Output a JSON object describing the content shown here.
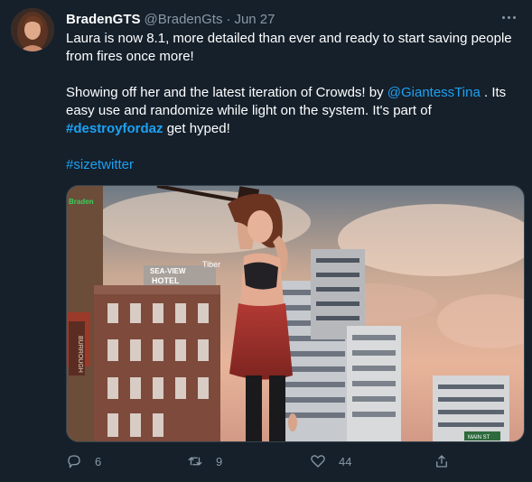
{
  "tweet": {
    "display_name": "BradenGTS",
    "handle": "@BradenGts",
    "separator": "·",
    "date": "Jun 27",
    "text": {
      "line1": "Laura is now 8.1, more detailed than ever and ready to start saving people from fires once more!",
      "p2_a": "Showing off her and the latest iteration of Crowds! by ",
      "p2_mention": "@GiantessTina",
      "p2_b": " . Its easy use and randomize while light on the system. It's part of ",
      "p2_hashtag": "#destroyfordaz",
      "p2_c": " get hyped!",
      "p3_hashtag": "#sizetwitter"
    },
    "media": {
      "watermark": "Braden",
      "sign_top": "SEA-VIEW",
      "sign_bottom": "HOTEL",
      "sign_tiber": "Tiber",
      "sign_vertical": "BURROUGH",
      "sign_street": "MAIN ST"
    },
    "actions": {
      "reply_count": "6",
      "retweet_count": "9",
      "like_count": "44"
    }
  },
  "colors": {
    "background": "#15202b",
    "text": "#ffffff",
    "secondary": "#8899a6",
    "accent": "#1da1f2",
    "border": "#38444d"
  },
  "icons": {
    "more": "more-dots-icon",
    "reply": "reply-icon",
    "retweet": "retweet-icon",
    "like": "heart-icon",
    "share": "share-icon"
  }
}
